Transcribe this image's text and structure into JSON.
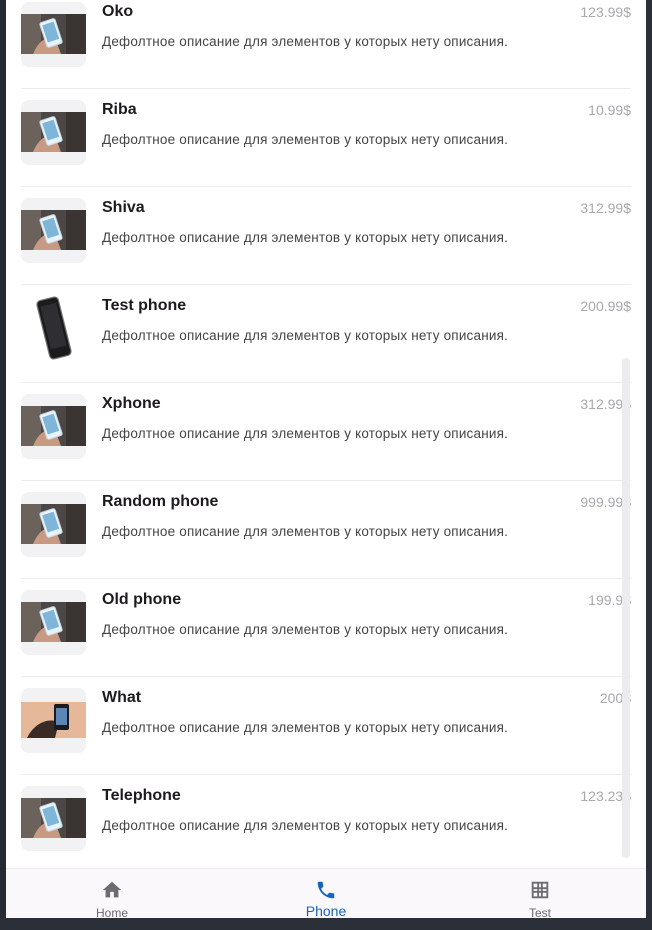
{
  "products": [
    {
      "name": "Oko",
      "price": "123.99$",
      "description": "Дефолтное описание для элементов у которых нету описания.",
      "image": "phone-in-hand"
    },
    {
      "name": "Riba",
      "price": "10.99$",
      "description": "Дефолтное описание для элементов у которых нету описания.",
      "image": "phone-in-hand"
    },
    {
      "name": "Shiva",
      "price": "312.99$",
      "description": "Дефолтное описание для элементов у которых нету описания.",
      "image": "phone-in-hand"
    },
    {
      "name": "Test phone",
      "price": "200.99$",
      "description": "Дефолтное описание для элементов у которых нету описания.",
      "image": "black-phone"
    },
    {
      "name": "Xphone",
      "price": "312.99$",
      "description": "Дефолтное описание для элементов у которых нету описания.",
      "image": "phone-in-hand"
    },
    {
      "name": "Random phone",
      "price": "999.99$",
      "description": "Дефолтное описание для элементов у которых нету описания.",
      "image": "phone-in-hand"
    },
    {
      "name": "Old phone",
      "price": "199.9$",
      "description": "Дефолтное описание для элементов у которых нету описания.",
      "image": "phone-in-hand"
    },
    {
      "name": "What",
      "price": "200$",
      "description": "Дефолтное описание для элементов у которых нету описания.",
      "image": "iphone-hand-peach"
    },
    {
      "name": "Telephone",
      "price": "123.23$",
      "description": "Дефолтное описание для элементов у которых нету описания.",
      "image": "phone-in-hand"
    }
  ],
  "nav": {
    "home": {
      "label": "Home",
      "icon": "home-icon"
    },
    "phone": {
      "label": "Phone",
      "icon": "phone-icon"
    },
    "test": {
      "label": "Test",
      "icon": "grid-icon"
    },
    "active": "phone"
  },
  "colors": {
    "accent": "#1565c0",
    "price": "#a8a8ad",
    "nav_background": "#fbf8fb"
  }
}
